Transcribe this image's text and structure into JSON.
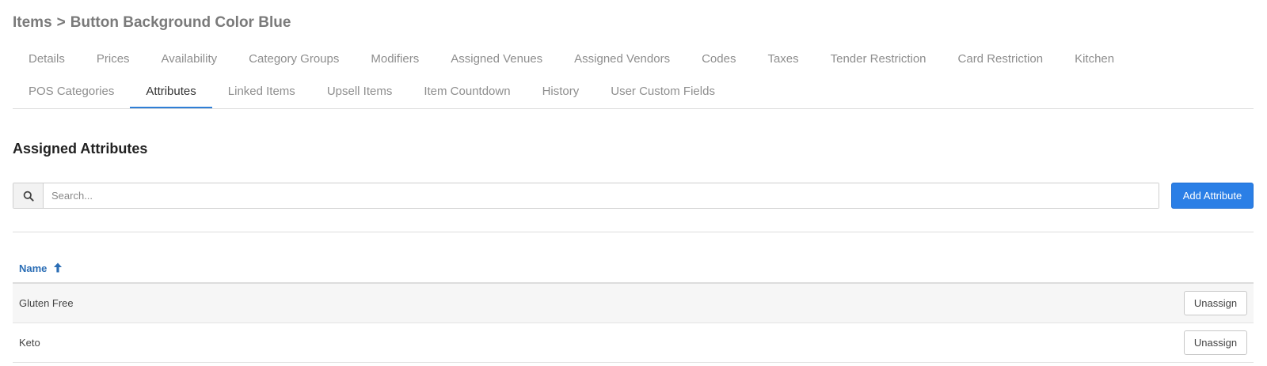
{
  "breadcrumb": {
    "parent": "Items",
    "separator": ">",
    "current": "Button Background Color Blue"
  },
  "tabs_row1": [
    {
      "label": "Details"
    },
    {
      "label": "Prices"
    },
    {
      "label": "Availability"
    },
    {
      "label": "Category Groups"
    },
    {
      "label": "Modifiers"
    },
    {
      "label": "Assigned Venues"
    },
    {
      "label": "Assigned Vendors"
    },
    {
      "label": "Codes"
    },
    {
      "label": "Taxes"
    },
    {
      "label": "Tender Restriction"
    },
    {
      "label": "Card Restriction"
    },
    {
      "label": "Kitchen"
    }
  ],
  "tabs_row2": [
    {
      "label": "POS Categories"
    },
    {
      "label": "Attributes",
      "active": true
    },
    {
      "label": "Linked Items"
    },
    {
      "label": "Upsell Items"
    },
    {
      "label": "Item Countdown"
    },
    {
      "label": "History"
    },
    {
      "label": "User Custom Fields"
    }
  ],
  "section": {
    "title": "Assigned Attributes"
  },
  "search": {
    "placeholder": "Search...",
    "value": "",
    "icon": "search-icon"
  },
  "add_button": {
    "label": "Add Attribute",
    "color": "#2b7fe6"
  },
  "table": {
    "header": {
      "name": "Name",
      "sort": "ascending",
      "sort_icon": "arrow-up-icon"
    },
    "rows": [
      {
        "name": "Gluten Free",
        "action": "Unassign"
      },
      {
        "name": "Keto",
        "action": "Unassign"
      }
    ]
  },
  "colors": {
    "accent": "#2f7fd6",
    "header_link": "#2a6db5"
  }
}
